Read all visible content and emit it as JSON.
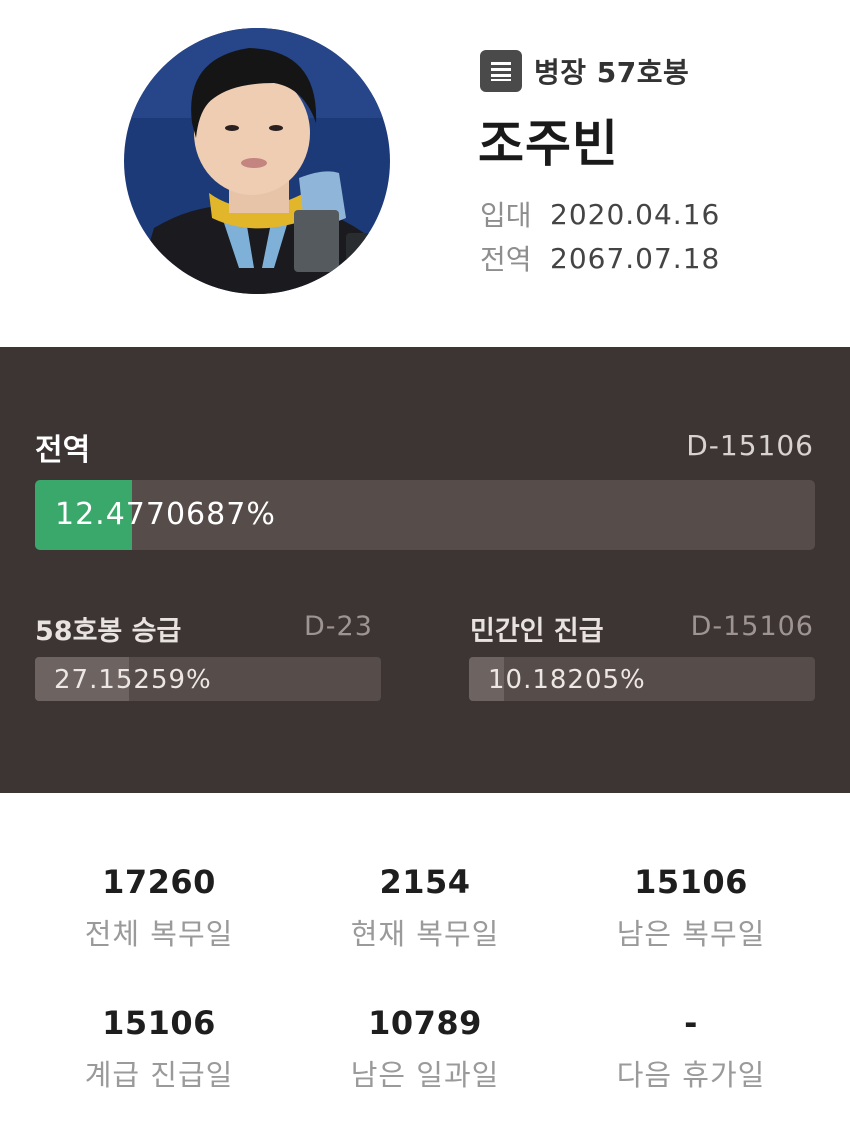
{
  "profile": {
    "rank": "병장 57호봉",
    "rank_icon": "list-icon",
    "name": "조주빈",
    "enlist_label": "입대",
    "enlist_date": "2020.04.16",
    "discharge_label": "전역",
    "discharge_date": "2067.07.18"
  },
  "progress": {
    "main": {
      "label": "전역",
      "dday": "D-15106",
      "percent_text": "12.4770687%",
      "fraction": 0.124770687
    },
    "promotion": {
      "label": "58호봉 승급",
      "dday": "D-23",
      "percent_text": "27.15259%",
      "fraction": 0.2715259
    },
    "civilian": {
      "label": "민간인 진급",
      "dday": "D-15106",
      "percent_text": "10.18205%",
      "fraction": 0.1018205
    }
  },
  "stats": [
    {
      "value": "17260",
      "label": "전체 복무일"
    },
    {
      "value": "2154",
      "label": "현재 복무일"
    },
    {
      "value": "15106",
      "label": "남은 복무일"
    },
    {
      "value": "15106",
      "label": "계급 진급일"
    },
    {
      "value": "10789",
      "label": "남은 일과일"
    },
    {
      "value": "-",
      "label": "다음 휴가일"
    }
  ],
  "colors": {
    "panel_bg": "#3d3533",
    "bar_track": "#564c4a",
    "main_fill": "#3aa86b",
    "sub_fill": "#6d6361"
  }
}
